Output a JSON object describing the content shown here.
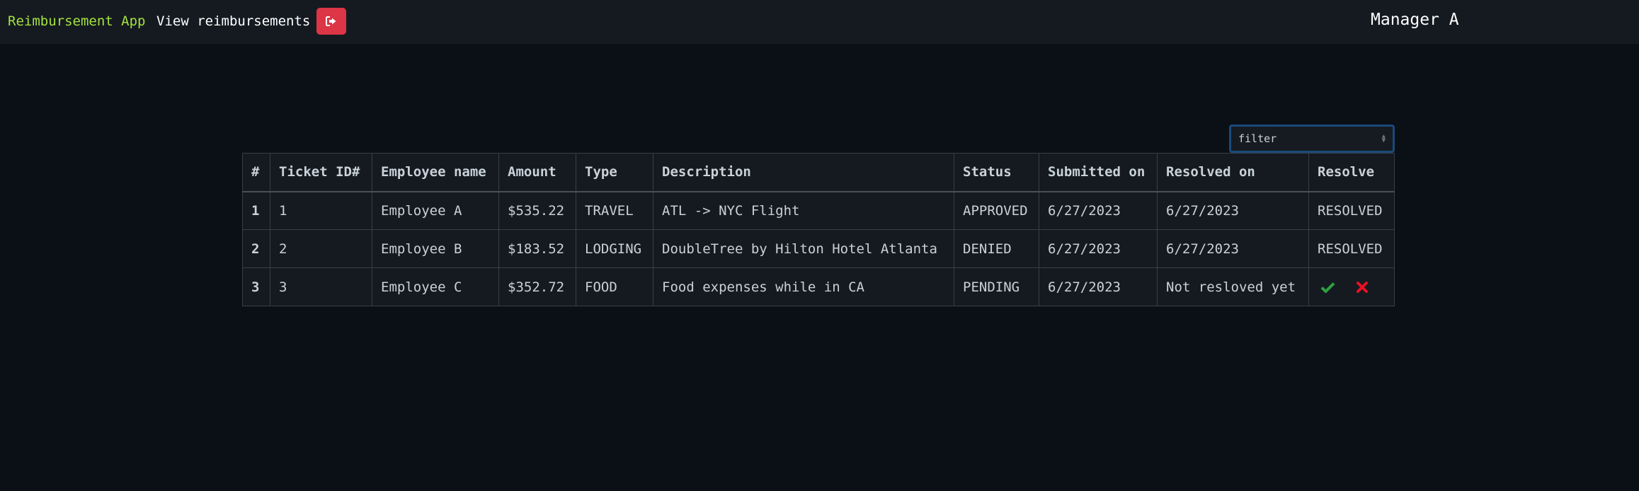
{
  "navbar": {
    "brand": "Reimbursement App",
    "view_link": "View reimbursements",
    "logout_icon": "sign-out-icon",
    "user_name": "Manager A"
  },
  "filter": {
    "selected": "filter"
  },
  "table": {
    "headers": [
      "#",
      "Ticket ID#",
      "Employee name",
      "Amount",
      "Type",
      "Description",
      "Status",
      "Submitted on",
      "Resolved on",
      "Resolve"
    ],
    "rows": [
      {
        "index": "1",
        "ticket_id": "1",
        "employee": "Employee A",
        "amount": "$535.22",
        "type": "TRAVEL",
        "description": "ATL -> NYC Flight",
        "status": "APPROVED",
        "submitted_on": "6/27/2023",
        "resolved_on": "6/27/2023",
        "resolve": "RESOLVED"
      },
      {
        "index": "2",
        "ticket_id": "2",
        "employee": "Employee B",
        "amount": "$183.52",
        "type": "LODGING",
        "description": "DoubleTree by Hilton Hotel Atlanta",
        "status": "DENIED",
        "submitted_on": "6/27/2023",
        "resolved_on": "6/27/2023",
        "resolve": "RESOLVED"
      },
      {
        "index": "3",
        "ticket_id": "3",
        "employee": "Employee C",
        "amount": "$352.72",
        "type": "FOOD",
        "description": "Food expenses while in CA",
        "status": "PENDING",
        "submitted_on": "6/27/2023",
        "resolved_on": "Not resloved yet",
        "resolve": ""
      }
    ]
  },
  "colors": {
    "brand": "#a4e33c",
    "logout_button": "#dc3545",
    "approve_icon": "#2ea043",
    "deny_icon": "#e81123"
  }
}
